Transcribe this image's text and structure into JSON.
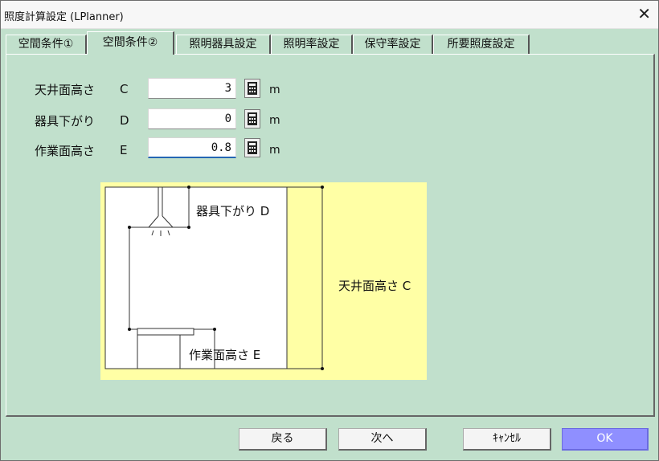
{
  "window": {
    "title": "照度計算設定 (LPlanner)",
    "close_label": "✕"
  },
  "tabs": [
    {
      "label": "空間条件①"
    },
    {
      "label": "空間条件②"
    },
    {
      "label": "照明器具設定"
    },
    {
      "label": "照明率設定"
    },
    {
      "label": "保守率設定"
    },
    {
      "label": "所要照度設定"
    }
  ],
  "active_tab": 1,
  "fields": [
    {
      "label": "天井面高さ",
      "letter": "C",
      "value": "3",
      "unit": "m"
    },
    {
      "label": "器具下がり",
      "letter": "D",
      "value": "0",
      "unit": "m"
    },
    {
      "label": "作業面高さ",
      "letter": "E",
      "value": "0.8",
      "unit": "m"
    }
  ],
  "calc_icon": "calculator-icon",
  "diagram": {
    "fixture_label": "器具下がり D",
    "ceiling_label": "天井面高さ C",
    "work_label": "作業面高さ E"
  },
  "buttons": {
    "back": "戻る",
    "next": "次へ",
    "cancel": "ｷｬﾝｾﾙ",
    "ok": "OK"
  },
  "colors": {
    "panel_bg": "#c1e0cc",
    "diagram_bg": "#ffffa5",
    "ok_button": "#8f8fff",
    "focus_underline": "#2566b3"
  }
}
